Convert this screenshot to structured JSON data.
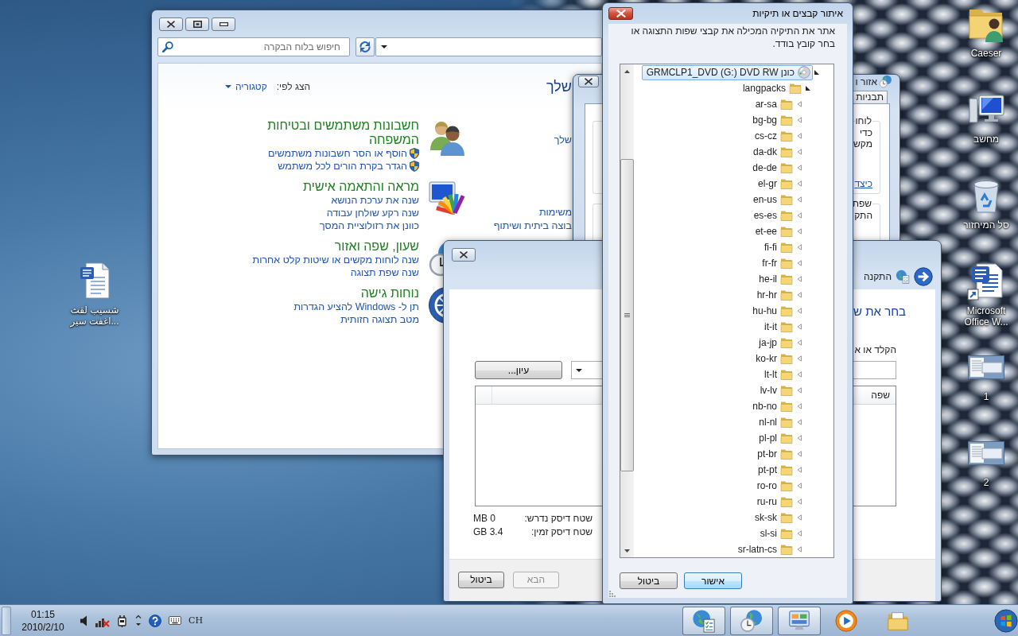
{
  "desktop": {
    "left_icons": [
      {
        "kind": "word-doc",
        "label": "شسيب لقث اغفت سير..."
      }
    ],
    "right_icons": [
      {
        "kind": "user-folder",
        "label": "Caeser"
      },
      {
        "kind": "computer",
        "label": "מחשב"
      },
      {
        "kind": "recycle-bin",
        "label": "סל המיחזור"
      },
      {
        "kind": "word-shortcut",
        "label": "Microsoft Office W..."
      },
      {
        "kind": "thumbnail",
        "label": "1"
      },
      {
        "kind": "thumbnail",
        "label": "2"
      }
    ]
  },
  "control_panel": {
    "search": {
      "placeholder": "חיפוש בלוח הבקרה"
    },
    "heading": "שלך",
    "view_by": {
      "label": "הצג לפי:",
      "value": "קטגוריה"
    },
    "column_1_links": [
      "שלך",
      "משימות",
      "בוצה ביתית ושיתוף"
    ],
    "categories": [
      {
        "kind": "users",
        "title": "חשבונות משתמשים ובטיחות המשפחה",
        "links": [
          {
            "text": "הוסף או הסר חשבונות משתמשים",
            "shield": true
          },
          {
            "text": "הגדר בקרת הורים לכל משתמש",
            "shield": true
          }
        ]
      },
      {
        "kind": "appearance",
        "title": "מראה והתאמה אישית",
        "links": [
          {
            "text": "שנה את ערכת הנושא",
            "shield": false
          },
          {
            "text": "שנה רקע שולחן עבודה",
            "shield": false
          },
          {
            "text": "כוונן את רזולוציית המסך",
            "shield": false
          }
        ]
      },
      {
        "kind": "clock",
        "title": "שעון, שפה ואזור",
        "links": [
          {
            "text": "שנה לוחות מקשים או שיטות קלט אחרות",
            "shield": false
          },
          {
            "text": "שנה שפת תצוגה",
            "shield": false
          }
        ]
      },
      {
        "kind": "access",
        "title": "נוחות גישה",
        "links": [
          {
            "text": "תן ל- Windows להציע הגדרות",
            "shield": false
          },
          {
            "text": "מטב תצוגה חזותית",
            "shield": false
          }
        ]
      }
    ]
  },
  "region_window": {
    "title": "אזור ו",
    "tabs": [
      {
        "label": "תבניות",
        "selected": false
      }
    ],
    "groups": [
      {
        "label": "לוחו",
        "lines": [
          "כדי",
          "מקש"
        ],
        "link": "כיצד"
      },
      {
        "label": "שפת",
        "lines": [
          "התק"
        ]
      }
    ]
  },
  "install_window": {
    "title": "התקנה",
    "heading": "בחר את ש",
    "prompt": "הקלד או א",
    "browse_button": "עיון...",
    "columns": [
      "שפה"
    ],
    "disk_space": [
      {
        "label": "שטח דיסק נדרש:",
        "value": "MB 0"
      },
      {
        "label": "שטח דיסק זמין:",
        "value": "GB 3.4"
      }
    ],
    "buttons": [
      {
        "label": "הבא",
        "disabled": true
      },
      {
        "label": "ביטול",
        "disabled": false
      }
    ]
  },
  "browse_dialog": {
    "title": "איתור קבצים או תיקיות",
    "instruction": "אתר את התיקיה המכילה את קבצי שפות התצוגה או בחר קובץ בודד.",
    "tree": [
      {
        "kind": "drive",
        "label": "GRMCLP1_DVD (G:) DVD RW כונן",
        "selected": true,
        "expanded": true,
        "children": [
          {
            "kind": "folder",
            "label": "langpacks",
            "selected": false,
            "expanded": true,
            "children": [
              {
                "kind": "folder",
                "label": "ar-sa",
                "selected": false,
                "expanded": false
              },
              {
                "kind": "folder",
                "label": "bg-bg",
                "selected": false,
                "expanded": false
              },
              {
                "kind": "folder",
                "label": "cs-cz",
                "selected": false,
                "expanded": false
              },
              {
                "kind": "folder",
                "label": "da-dk",
                "selected": false,
                "expanded": false
              },
              {
                "kind": "folder",
                "label": "de-de",
                "selected": false,
                "expanded": false
              },
              {
                "kind": "folder",
                "label": "el-gr",
                "selected": false,
                "expanded": false
              },
              {
                "kind": "folder",
                "label": "en-us",
                "selected": false,
                "expanded": false
              },
              {
                "kind": "folder",
                "label": "es-es",
                "selected": false,
                "expanded": false
              },
              {
                "kind": "folder",
                "label": "et-ee",
                "selected": false,
                "expanded": false
              },
              {
                "kind": "folder",
                "label": "fi-fi",
                "selected": false,
                "expanded": false
              },
              {
                "kind": "folder",
                "label": "fr-fr",
                "selected": false,
                "expanded": false
              },
              {
                "kind": "folder",
                "label": "he-il",
                "selected": false,
                "expanded": false
              },
              {
                "kind": "folder",
                "label": "hr-hr",
                "selected": false,
                "expanded": false
              },
              {
                "kind": "folder",
                "label": "hu-hu",
                "selected": false,
                "expanded": false
              },
              {
                "kind": "folder",
                "label": "it-it",
                "selected": false,
                "expanded": false
              },
              {
                "kind": "folder",
                "label": "ja-jp",
                "selected": false,
                "expanded": false
              },
              {
                "kind": "folder",
                "label": "ko-kr",
                "selected": false,
                "expanded": false
              },
              {
                "kind": "folder",
                "label": "lt-lt",
                "selected": false,
                "expanded": false
              },
              {
                "kind": "folder",
                "label": "lv-lv",
                "selected": false,
                "expanded": false
              },
              {
                "kind": "folder",
                "label": "nb-no",
                "selected": false,
                "expanded": false
              },
              {
                "kind": "folder",
                "label": "nl-nl",
                "selected": false,
                "expanded": false
              },
              {
                "kind": "folder",
                "label": "pl-pl",
                "selected": false,
                "expanded": false
              },
              {
                "kind": "folder",
                "label": "pt-br",
                "selected": false,
                "expanded": false
              },
              {
                "kind": "folder",
                "label": "pt-pt",
                "selected": false,
                "expanded": false
              },
              {
                "kind": "folder",
                "label": "ro-ro",
                "selected": false,
                "expanded": false
              },
              {
                "kind": "folder",
                "label": "ru-ru",
                "selected": false,
                "expanded": false
              },
              {
                "kind": "folder",
                "label": "sk-sk",
                "selected": false,
                "expanded": false
              },
              {
                "kind": "folder",
                "label": "sl-si",
                "selected": false,
                "expanded": false
              },
              {
                "kind": "folder",
                "label": "sr-latn-cs",
                "selected": false,
                "expanded": false
              }
            ]
          }
        ]
      }
    ],
    "buttons": [
      {
        "label": "אישור",
        "default": true
      },
      {
        "label": "ביטול",
        "default": false
      }
    ]
  },
  "taskbar": {
    "time": "01:15",
    "date": "2010/2/10",
    "language": "CH"
  }
}
